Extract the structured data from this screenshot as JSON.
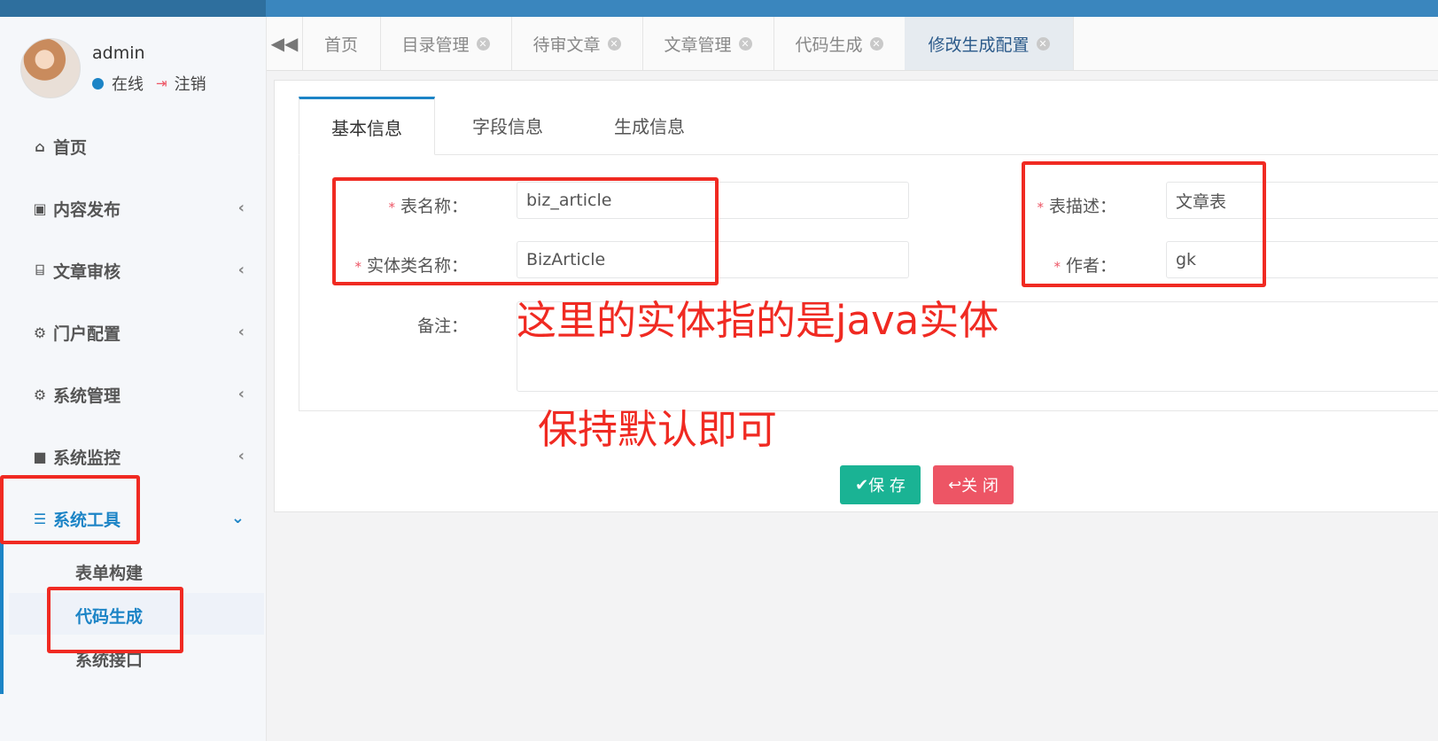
{
  "user": {
    "name": "admin",
    "status": "在线",
    "logout": "注销"
  },
  "sidebar": {
    "items": [
      {
        "label": "首页",
        "icon": "home-icon"
      },
      {
        "label": "内容发布",
        "icon": "briefcase-icon"
      },
      {
        "label": "文章审核",
        "icon": "bank-icon"
      },
      {
        "label": "门户配置",
        "icon": "gear-icon"
      },
      {
        "label": "系统管理",
        "icon": "gear-icon"
      },
      {
        "label": "系统监控",
        "icon": "video-icon"
      },
      {
        "label": "系统工具",
        "icon": "list-icon"
      }
    ],
    "subitems": [
      "表单构建",
      "代码生成",
      "系统接口"
    ]
  },
  "tabs": [
    "首页",
    "目录管理",
    "待审文章",
    "文章管理",
    "代码生成",
    "修改生成配置"
  ],
  "panel_tabs": [
    "基本信息",
    "字段信息",
    "生成信息"
  ],
  "form": {
    "table_name_label": "表名称：",
    "table_name_value": "biz_article",
    "class_name_label": "实体类名称：",
    "class_name_value": "BizArticle",
    "remark_label": "备注：",
    "table_desc_label": "表描述：",
    "table_desc_value": "文章表",
    "author_label": "作者：",
    "author_value": "gk"
  },
  "buttons": {
    "save": "保 存",
    "close": "关 闭"
  },
  "annotations": {
    "note1": "这里的实体指的是java实体",
    "note2": "保持默认即可"
  },
  "colors": {
    "accent": "#1c84c6",
    "save": "#1ab394",
    "close": "#ed5565",
    "annotation": "#f02a22"
  }
}
